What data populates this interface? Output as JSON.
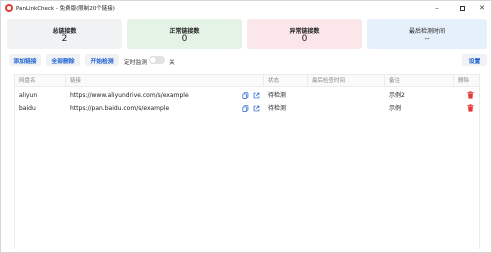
{
  "window": {
    "title": "PanLinkCheck - 免费版(限制20个链接)",
    "controls": {
      "minimize": "–",
      "close": "✕"
    }
  },
  "stats": {
    "total": {
      "label": "总链接数",
      "value": "2"
    },
    "normal": {
      "label": "正常链接数",
      "value": "0"
    },
    "abnormal": {
      "label": "异常链接数",
      "value": "0"
    },
    "last_check": {
      "label": "最后检测时间",
      "value": "--"
    }
  },
  "toolbar": {
    "add_label": "添加链接",
    "delete_all_label": "全部删除",
    "start_label": "开始检测",
    "timer_label": "定时监测",
    "timer_state": "关",
    "settings_label": "设置"
  },
  "table": {
    "headers": {
      "name": "网盘名",
      "link": "链接",
      "status": "状态",
      "last_check": "最后检查时间",
      "remark": "备注",
      "delete": "删除"
    },
    "rows": [
      {
        "name": "aliyun",
        "link": "https://www.aliyundrive.com/s/example",
        "status": "待检测",
        "last_check": "",
        "remark": "示例2"
      },
      {
        "name": "baidu",
        "link": "https://pan.baidu.com/s/example",
        "status": "待检测",
        "last_check": "",
        "remark": "示例"
      }
    ]
  },
  "colors": {
    "accent": "#1a5fd0",
    "danger": "#e53935",
    "card_total": "#f1f2f4",
    "card_normal": "#e5f3e7",
    "card_abnormal": "#fbe7ea",
    "card_last": "#e6f0fb"
  },
  "icons": {
    "app": "app-logo-icon",
    "copy": "copy-icon",
    "open": "open-external-icon",
    "delete": "trash-icon"
  }
}
